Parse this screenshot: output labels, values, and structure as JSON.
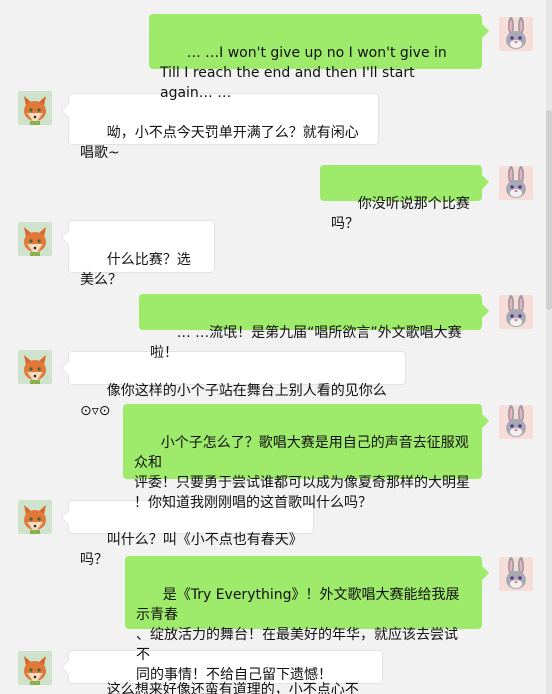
{
  "messages": [
    {
      "sender": "rabbit",
      "text": "… …I won't give up no I won't give in\nTill I reach the end and then I'll start again… …"
    },
    {
      "sender": "fox",
      "text": "呦，小不点今天罚单开满了么？就有闲心唱歌~"
    },
    {
      "sender": "rabbit",
      "text": "你没听说那个比赛吗？"
    },
    {
      "sender": "fox",
      "text": "什么比赛？选美么？"
    },
    {
      "sender": "rabbit",
      "text": "… …流氓！是第九届“唱所欲言”外文歌唱大赛啦！"
    },
    {
      "sender": "fox",
      "text": "像你这样的小个子站在舞台上别人看的见你么⊙▿⊙"
    },
    {
      "sender": "rabbit",
      "text": "小个子怎么了？歌唱大赛是用自己的声音去征服观众和\n评委！只要勇于尝试谁都可以成为像夏奇那样的大明星\n！你知道我刚刚唱的这首歌叫什么吗？"
    },
    {
      "sender": "fox",
      "text": "叫什么？叫《小不点也有春天》吗？"
    },
    {
      "sender": "rabbit",
      "text": "是《Try Everything》！外文歌唱大赛能给我展示青春\n、绽放活力的舞台！在最美好的年华，就应该去尝试不\n同的事情！不给自己留下遗憾！"
    },
    {
      "sender": "fox",
      "text": "这么想来好像还蛮有道理的，小不点心不小嘛！"
    }
  ],
  "avatars": {
    "fox": "fox-avatar-icon",
    "rabbit": "rabbit-avatar-icon"
  },
  "colors": {
    "background": "#f2f2f2",
    "sent_bubble": "#9eea6a",
    "received_bubble": "#ffffff"
  }
}
